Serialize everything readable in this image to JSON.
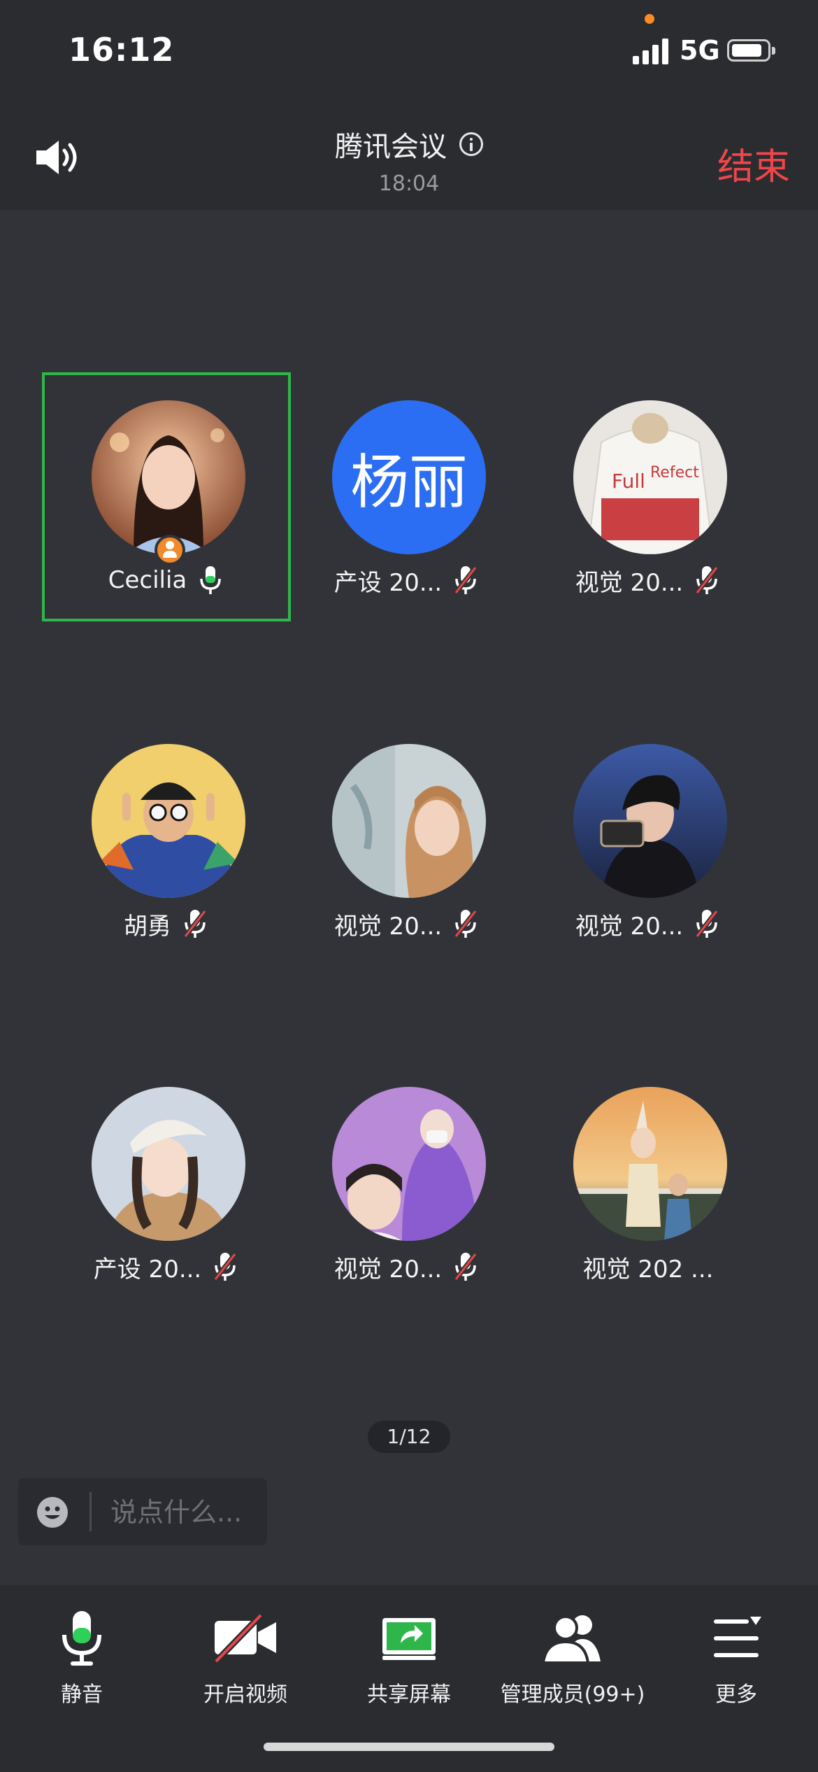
{
  "status_bar": {
    "time": "16:12",
    "network": "5G"
  },
  "header": {
    "title": "腾讯会议",
    "duration": "18:04",
    "end_label": "结束"
  },
  "participants": [
    {
      "name": "Cecilia",
      "mic": "on",
      "host": true,
      "active": true,
      "avatar": "photo-girl-portrait"
    },
    {
      "name": "产设 20...",
      "mic": "muted",
      "avatar_text": "杨丽",
      "avatar_color": "#2b6ef4"
    },
    {
      "name": "视觉 20...",
      "mic": "muted",
      "avatar": "photo-bag-cat"
    },
    {
      "name": "胡勇",
      "mic": "muted",
      "avatar": "illustration-peace-sign"
    },
    {
      "name": "视觉 20...",
      "mic": "muted",
      "avatar": "photo-girl-blonde"
    },
    {
      "name": "视觉 20...",
      "mic": "muted",
      "avatar": "photo-boy-camera"
    },
    {
      "name": "产设 20...",
      "mic": "muted",
      "avatar": "photo-girl-beret"
    },
    {
      "name": "视觉 20...",
      "mic": "muted",
      "avatar": "photo-boys-purple"
    },
    {
      "name": "视觉 202 ...",
      "mic": "none",
      "avatar": "illustration-sunset-girls"
    }
  ],
  "page_indicator": "1/12",
  "chat": {
    "placeholder": "说点什么..."
  },
  "toolbar": {
    "mute_label": "静音",
    "video_label": "开启视频",
    "share_label": "共享屏幕",
    "members_label": "管理成员(99+)",
    "more_label": "更多"
  },
  "colors": {
    "end": "#f0464b",
    "active_border": "#2fb64a",
    "mic_on": "#2fd05a",
    "mute_slash": "#e84646",
    "share": "#2fb64a"
  }
}
